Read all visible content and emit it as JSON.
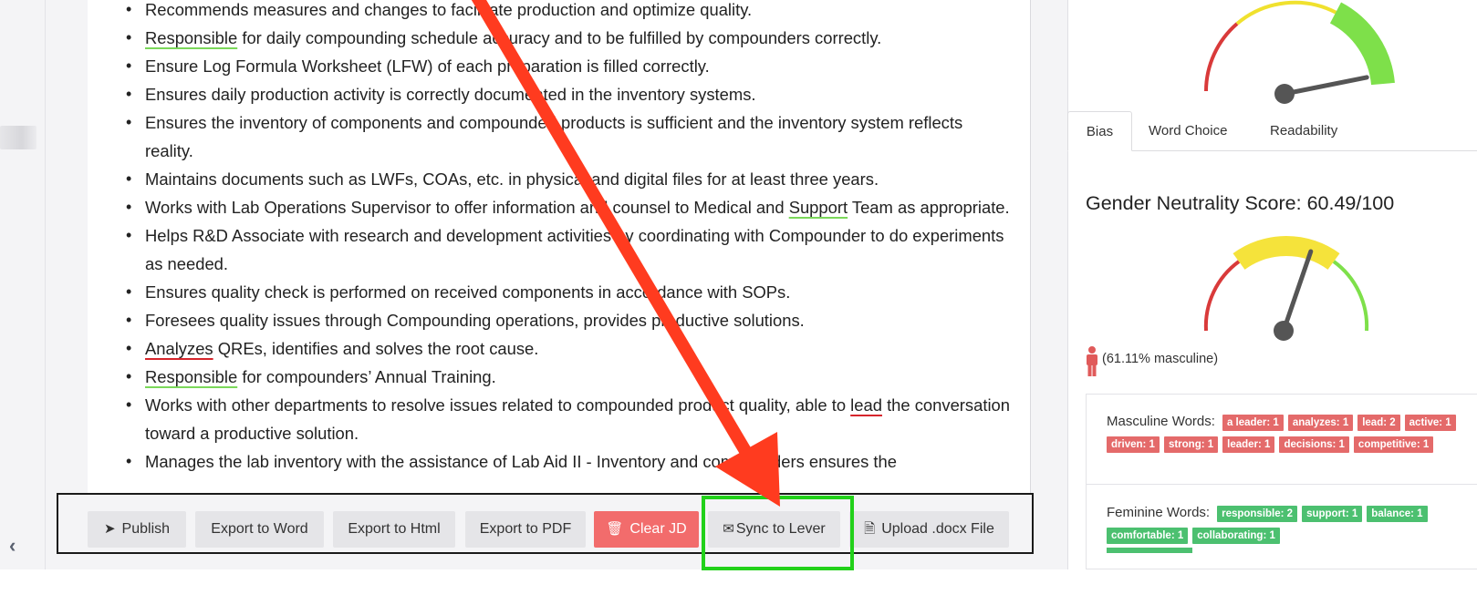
{
  "document": {
    "bullets": [
      [
        {
          "t": "Recommends measures and changes to facilitate production and optimize quality."
        }
      ],
      [
        {
          "t": "Responsible",
          "u": "green"
        },
        {
          "t": " for daily compounding schedule accuracy and to be fulfilled by compounders correctly."
        }
      ],
      [
        {
          "t": "Ensure Log Formula Worksheet (LFW) of each preparation is filled correctly."
        }
      ],
      [
        {
          "t": "Ensures daily production activity is correctly documented in the inventory systems."
        }
      ],
      [
        {
          "t": "Ensures the inventory of components and compounded products is sufficient and the inventory system reflects reality."
        }
      ],
      [
        {
          "t": "Maintains documents such as  LWFs, COAs, etc. in physical and digital files for at least three years."
        }
      ],
      [
        {
          "t": "Works with Lab Operations Supervisor to offer information and counsel to Medical and "
        },
        {
          "t": "Support",
          "u": "green"
        },
        {
          "t": " Team as appropriate."
        }
      ],
      [
        {
          "t": "Helps R&D Associate with research and development activities by coordinating with Compounder to do experiments as needed."
        }
      ],
      [
        {
          "t": "Ensures quality check is performed on received components in accordance with SOPs."
        }
      ],
      [
        {
          "t": "Foresees quality issues through Compounding operations, provides productive solutions."
        }
      ],
      [
        {
          "t": "Analyzes",
          "u": "red"
        },
        {
          "t": " QREs, identifies and solves the root cause."
        }
      ],
      [
        {
          "t": "Responsible",
          "u": "green"
        },
        {
          "t": " for compounders’ Annual Training."
        }
      ],
      [
        {
          "t": "Works with other departments to resolve issues related to compounded product quality, able to "
        },
        {
          "t": "lead",
          "u": "red"
        },
        {
          "t": " the conversation toward a productive solution."
        }
      ],
      [
        {
          "t": "Manages the lab inventory with the assistance of Lab Aid II - Inventory and compounders ensures the"
        }
      ]
    ]
  },
  "toolbar": {
    "publish": "Publish",
    "export_word": "Export to Word",
    "export_html": "Export to Html",
    "export_pdf": "Export to PDF",
    "clear_jd": "Clear JD",
    "sync_lever": "Sync to Lever",
    "upload_docx": "Upload .docx File"
  },
  "analysis": {
    "tabs": [
      "Bias",
      "Word Choice",
      "Readability"
    ],
    "active_tab": "Bias",
    "top_gauge_value": 0.82,
    "score_title": "Gender Neutrality Score: 60.49/100",
    "score_value": 60.49,
    "gender_label": "(61.11% masculine)",
    "masculine_label": "Masculine Words:",
    "masculine_words": [
      "a leader: 1",
      "analyzes: 1",
      "lead: 2",
      "active: 1",
      "driven: 1",
      "strong: 1",
      "leader: 1",
      "decisions: 1",
      "competitive: 1"
    ],
    "feminine_label": "Feminine Words:",
    "feminine_words": [
      "responsible: 2",
      "support: 1",
      "balance: 1",
      "comfortable: 1",
      "collaborating: 1"
    ]
  },
  "colors": {
    "clear_button": "#f26c6c",
    "highlight": "#22d11a",
    "arrow": "#ff3b1f",
    "masculine_chip": "#e46a6a",
    "feminine_chip": "#4cc070"
  }
}
